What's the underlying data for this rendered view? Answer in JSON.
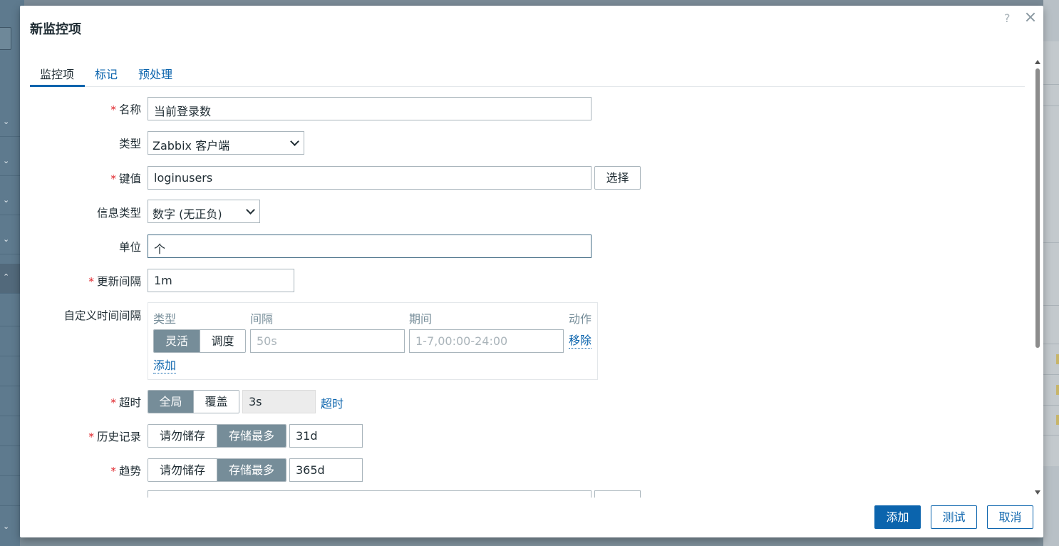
{
  "dialog": {
    "title": "新监控项",
    "help": "?"
  },
  "tabs": [
    {
      "label": "监控项"
    },
    {
      "label": "标记"
    },
    {
      "label": "预处理"
    }
  ],
  "form": {
    "name": {
      "label": "名称",
      "value": "当前登录数"
    },
    "type": {
      "label": "类型",
      "value": "Zabbix 客户端"
    },
    "key": {
      "label": "键值",
      "value": "loginusers",
      "select_button": "选择"
    },
    "info_type": {
      "label": "信息类型",
      "value": "数字 (无正负)"
    },
    "units": {
      "label": "单位",
      "value": "个"
    },
    "update_interval": {
      "label": "更新间隔",
      "value": "1m"
    },
    "custom_intervals": {
      "label": "自定义时间间隔",
      "col_type": "类型",
      "col_interval": "间隔",
      "col_period": "期间",
      "col_action": "动作",
      "seg_flexible": "灵活",
      "seg_scheduling": "调度",
      "interval_placeholder": "50s",
      "period_placeholder": "1-7,00:00-24:00",
      "remove_link": "移除",
      "add_link": "添加"
    },
    "timeout": {
      "label": "超时",
      "seg_global": "全局",
      "seg_override": "覆盖",
      "value": "3s",
      "link": "超时"
    },
    "history": {
      "label": "历史记录",
      "seg_no": "请勿储存",
      "seg_store": "存储最多",
      "value": "31d"
    },
    "trends": {
      "label": "趋势",
      "seg_no": "请勿储存",
      "seg_store": "存储最多",
      "value": "365d"
    }
  },
  "footer": {
    "add": "添加",
    "test": "测试",
    "cancel": "取消"
  },
  "colors": {
    "accent": "#0b64ad",
    "segment_active": "#768d99",
    "required": "#e0252b"
  }
}
